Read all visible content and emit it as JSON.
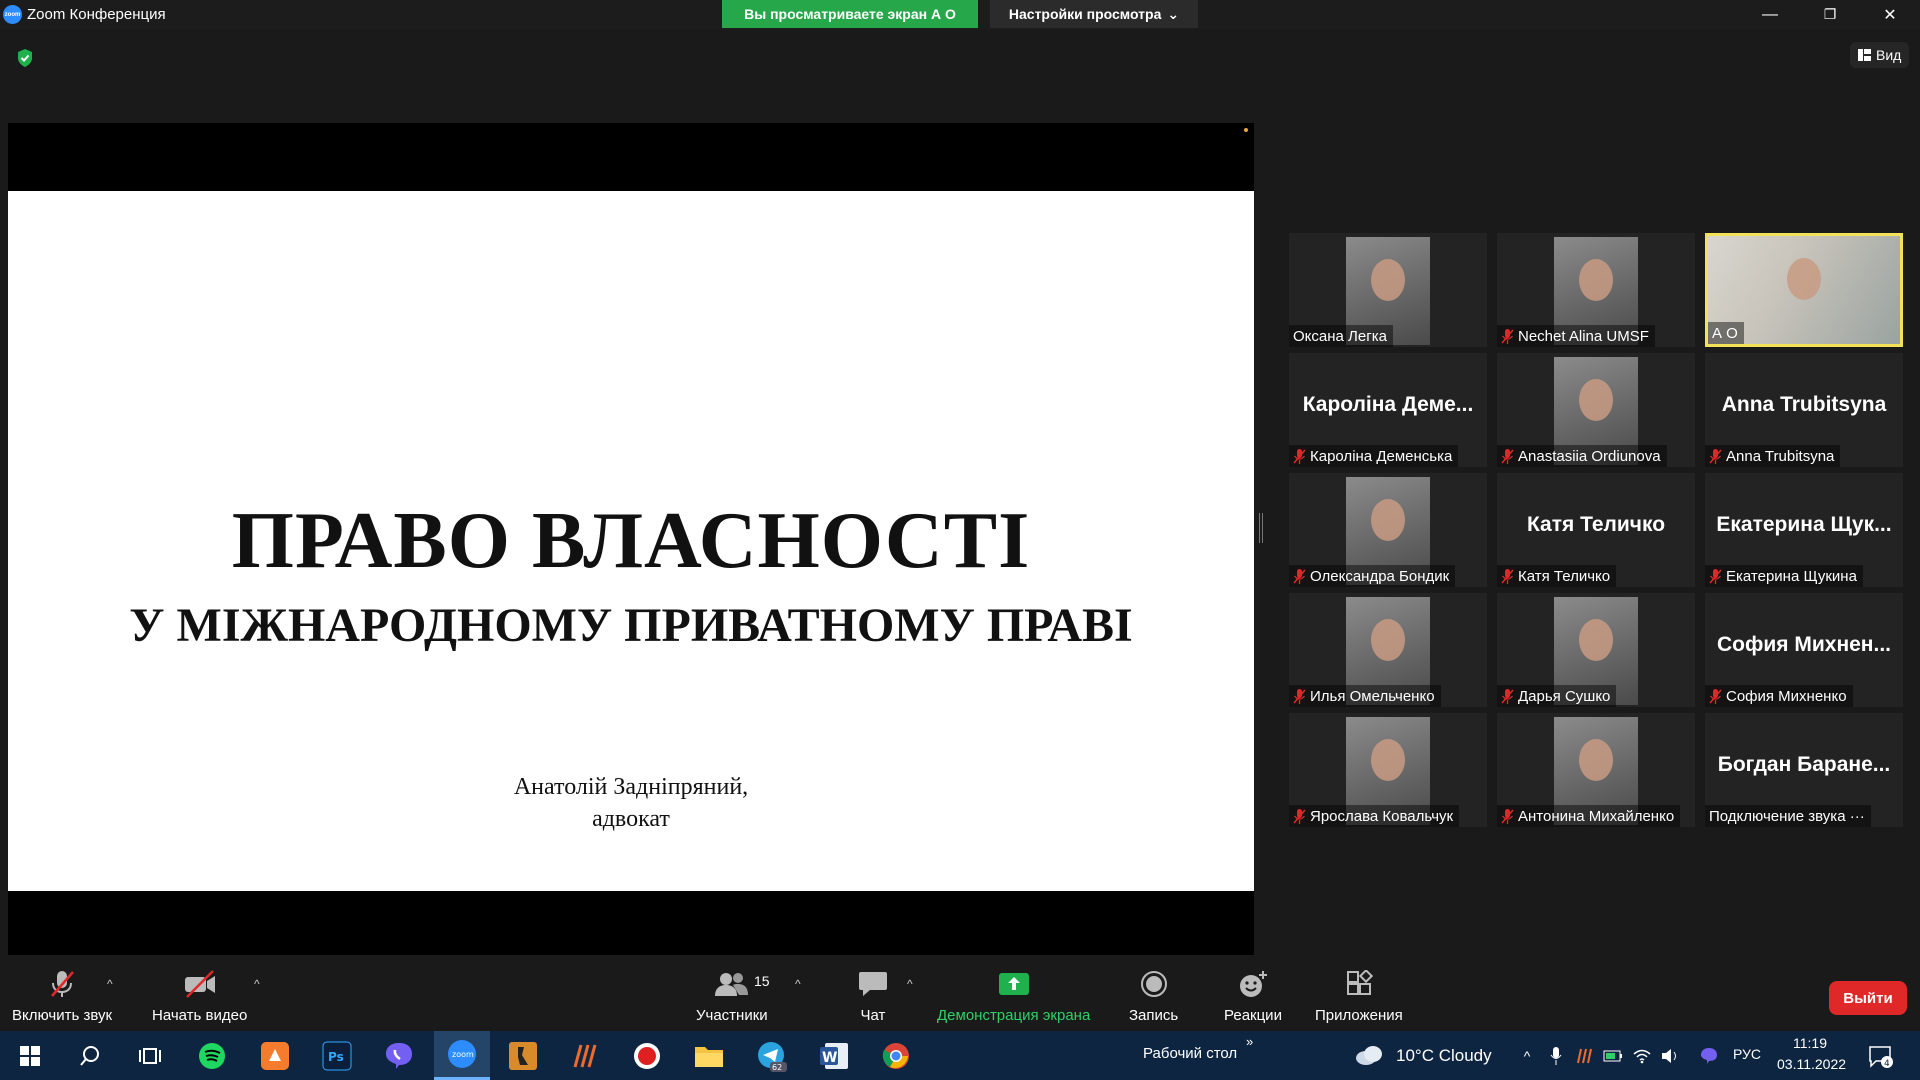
{
  "window": {
    "title": "Zoom Конференция",
    "viewing_banner": "Вы просматриваете экран А О",
    "view_settings": "Настройки просмотра",
    "minimize": "—",
    "restore": "❐",
    "close": "✕"
  },
  "top_right": {
    "view_label": "Вид"
  },
  "slide": {
    "title": "ПРАВО ВЛАСНОСТІ",
    "subtitle": "У МІЖНАРОДНОМУ ПРИВАТНОМУ ПРАВІ",
    "author_line1": "Анатолій Задніпряний,",
    "author_line2": "адвокат"
  },
  "participants": [
    {
      "label": "Оксана Легка",
      "bigname": "",
      "video": true,
      "muted": false,
      "active": false
    },
    {
      "label": "Nechet Alina UMSF",
      "bigname": "",
      "video": true,
      "muted": true,
      "active": false
    },
    {
      "label": "А О",
      "bigname": "",
      "video": true,
      "muted": false,
      "active": true
    },
    {
      "label": "Кароліна Деменська",
      "bigname": "Кароліна Деме...",
      "video": false,
      "muted": true,
      "active": false
    },
    {
      "label": "Anastasiia Ordiunova",
      "bigname": "",
      "video": true,
      "muted": true,
      "active": false
    },
    {
      "label": "Anna Trubitsyna",
      "bigname": "Anna Trubitsyna",
      "video": false,
      "muted": true,
      "active": false
    },
    {
      "label": "Олександра Бондик",
      "bigname": "",
      "video": true,
      "muted": true,
      "active": false
    },
    {
      "label": "Катя Теличко",
      "bigname": "Катя Теличко",
      "video": false,
      "muted": true,
      "active": false
    },
    {
      "label": "Екатерина Щукина",
      "bigname": "Екатерина Щук...",
      "video": false,
      "muted": true,
      "active": false
    },
    {
      "label": "Илья Омельченко",
      "bigname": "",
      "video": true,
      "muted": true,
      "active": false
    },
    {
      "label": "Дарья Сушко",
      "bigname": "",
      "video": true,
      "muted": true,
      "active": false
    },
    {
      "label": "София Михненко",
      "bigname": "София Михнен...",
      "video": false,
      "muted": true,
      "active": false
    },
    {
      "label": "Ярослава Ковальчук",
      "bigname": "",
      "video": true,
      "muted": true,
      "active": false
    },
    {
      "label": "Антонина Михайленко",
      "bigname": "",
      "video": true,
      "muted": true,
      "active": false
    },
    {
      "label": "Подключение звука ···",
      "bigname": "Богдан Баране...",
      "video": false,
      "muted": false,
      "active": false
    }
  ],
  "toolbar": {
    "unmute": "Включить звук",
    "start_video": "Начать видео",
    "participants": "Участники",
    "participants_count": "15",
    "chat": "Чат",
    "share_screen": "Демонстрация экрана",
    "record": "Запись",
    "reactions": "Реакции",
    "apps": "Приложения",
    "leave": "Выйти"
  },
  "taskbar": {
    "desktop_label": "Рабочий стол",
    "weather": "10°C  Cloudy",
    "language": "РУС",
    "time": "11:19",
    "date": "03.11.2022",
    "notifications": "4",
    "telegram_badge": "62"
  },
  "colors": {
    "green_banner": "#26a74a",
    "leave_red": "#e02828",
    "active_speaker": "#f2e25a",
    "share_green": "#2fd166",
    "taskbar": "#0e2542"
  }
}
